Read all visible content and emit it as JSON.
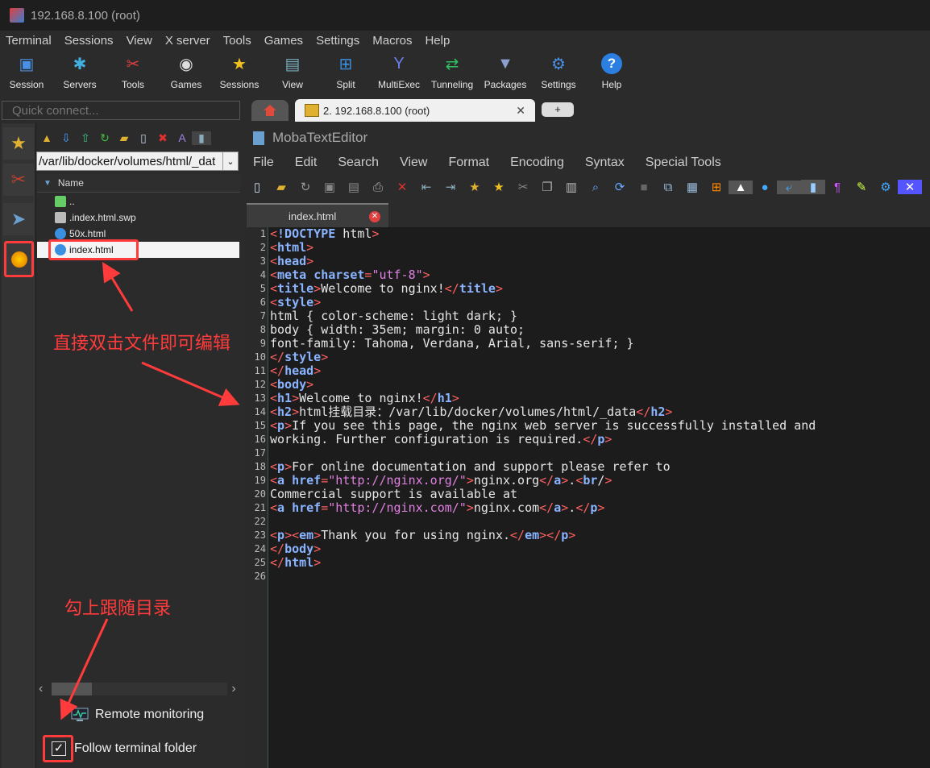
{
  "window": {
    "title": "192.168.8.100 (root)"
  },
  "menu": [
    "Terminal",
    "Sessions",
    "View",
    "X server",
    "Tools",
    "Games",
    "Settings",
    "Macros",
    "Help"
  ],
  "toolbar": [
    {
      "label": "Session",
      "icon": "session-icon"
    },
    {
      "label": "Servers",
      "icon": "servers-icon"
    },
    {
      "label": "Tools",
      "icon": "tools-icon"
    },
    {
      "label": "Games",
      "icon": "games-icon"
    },
    {
      "label": "Sessions",
      "icon": "star-icon"
    },
    {
      "label": "View",
      "icon": "view-icon"
    },
    {
      "label": "Split",
      "icon": "split-icon"
    },
    {
      "label": "MultiExec",
      "icon": "multiexec-icon"
    },
    {
      "label": "Tunneling",
      "icon": "tunneling-icon"
    },
    {
      "label": "Packages",
      "icon": "packages-icon"
    },
    {
      "label": "Settings",
      "icon": "gear-icon"
    },
    {
      "label": "Help",
      "icon": "help-icon"
    }
  ],
  "quick_connect": {
    "placeholder": "Quick connect..."
  },
  "tabs": {
    "session_label": "2. 192.168.8.100 (root)",
    "new_tab": "+"
  },
  "file_browser": {
    "path": "/var/lib/docker/volumes/html/_dat",
    "column": "Name",
    "files": [
      {
        "name": "..",
        "icon": "parent-folder-icon"
      },
      {
        "name": ".index.html.swp",
        "icon": "file-icon"
      },
      {
        "name": "50x.html",
        "icon": "html-file-icon"
      },
      {
        "name": "index.html",
        "icon": "html-file-icon",
        "selected": true
      }
    ],
    "remote_monitoring": "Remote monitoring",
    "follow_terminal": "Follow terminal folder",
    "follow_checked": true
  },
  "editor": {
    "title": "MobaTextEditor",
    "menu": [
      "File",
      "Edit",
      "Search",
      "View",
      "Format",
      "Encoding",
      "Syntax",
      "Special Tools"
    ],
    "tab": "index.html",
    "lines": [
      "<!DOCTYPE html>",
      "<html>",
      "<head>",
      "<meta charset=\"utf-8\">",
      "<title>Welcome to nginx!</title>",
      "<style>",
      "html { color-scheme: light dark; }",
      "body { width: 35em; margin: 0 auto;",
      "font-family: Tahoma, Verdana, Arial, sans-serif; }",
      "</style>",
      "</head>",
      "<body>",
      "<h1>Welcome to nginx!</h1>",
      "<h2>html挂载目录：/var/lib/docker/volumes/html/_data</h2>",
      "<p>If you see this page, the nginx web server is successfully installed and",
      "working. Further configuration is required.</p>",
      "",
      "<p>For online documentation and support please refer to",
      "<a href=\"http://nginx.org/\">nginx.org</a>.<br/>",
      "Commercial support is available at",
      "<a href=\"http://nginx.com/\">nginx.com</a>.</p>",
      "",
      "<p><em>Thank you for using nginx.</em></p>",
      "</body>",
      "</html>",
      ""
    ]
  },
  "annotations": {
    "edit_hint": "直接双击文件即可编辑",
    "follow_hint": "勾上跟随目录"
  },
  "colors": {
    "annotation": "#ff3b3b",
    "tag": "#8ab4ff",
    "bracket": "#ff6060",
    "string": "#e080e0"
  }
}
